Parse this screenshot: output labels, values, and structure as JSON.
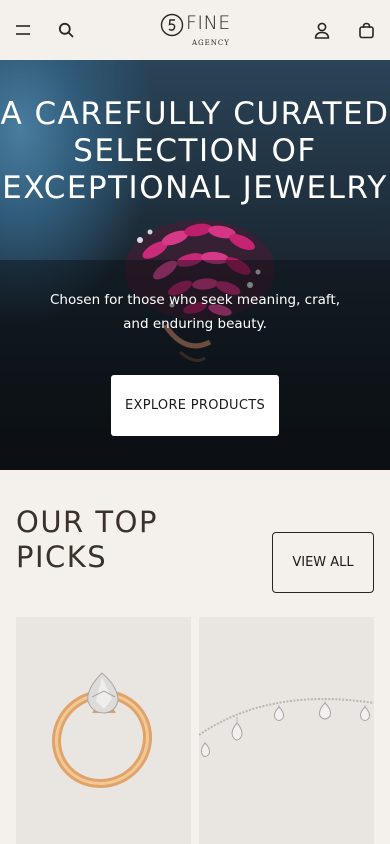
{
  "header": {
    "logo_text": "FINE",
    "logo_sub": "AGENCY",
    "icons": [
      "menu-icon",
      "search-icon",
      "account-icon",
      "bag-icon"
    ]
  },
  "hero": {
    "title": "A CAREFULLY CURATED SELECTION OF EXCEPTIONAL JEWELRY",
    "subtitle": "Chosen for those who seek meaning, craft, and enduring beauty.",
    "cta_label": "EXPLORE PRODUCTS"
  },
  "top_picks": {
    "title": "OUR TOP PICKS",
    "view_all_label": "VIEW ALL",
    "products": [
      {
        "image": "gold-pear-diamond-ring"
      },
      {
        "image": "diamond-drop-necklace"
      }
    ]
  },
  "colors": {
    "page_background": "#f4f0eb",
    "card_background": "#e9e6e2",
    "text_dark": "#2b2422"
  }
}
